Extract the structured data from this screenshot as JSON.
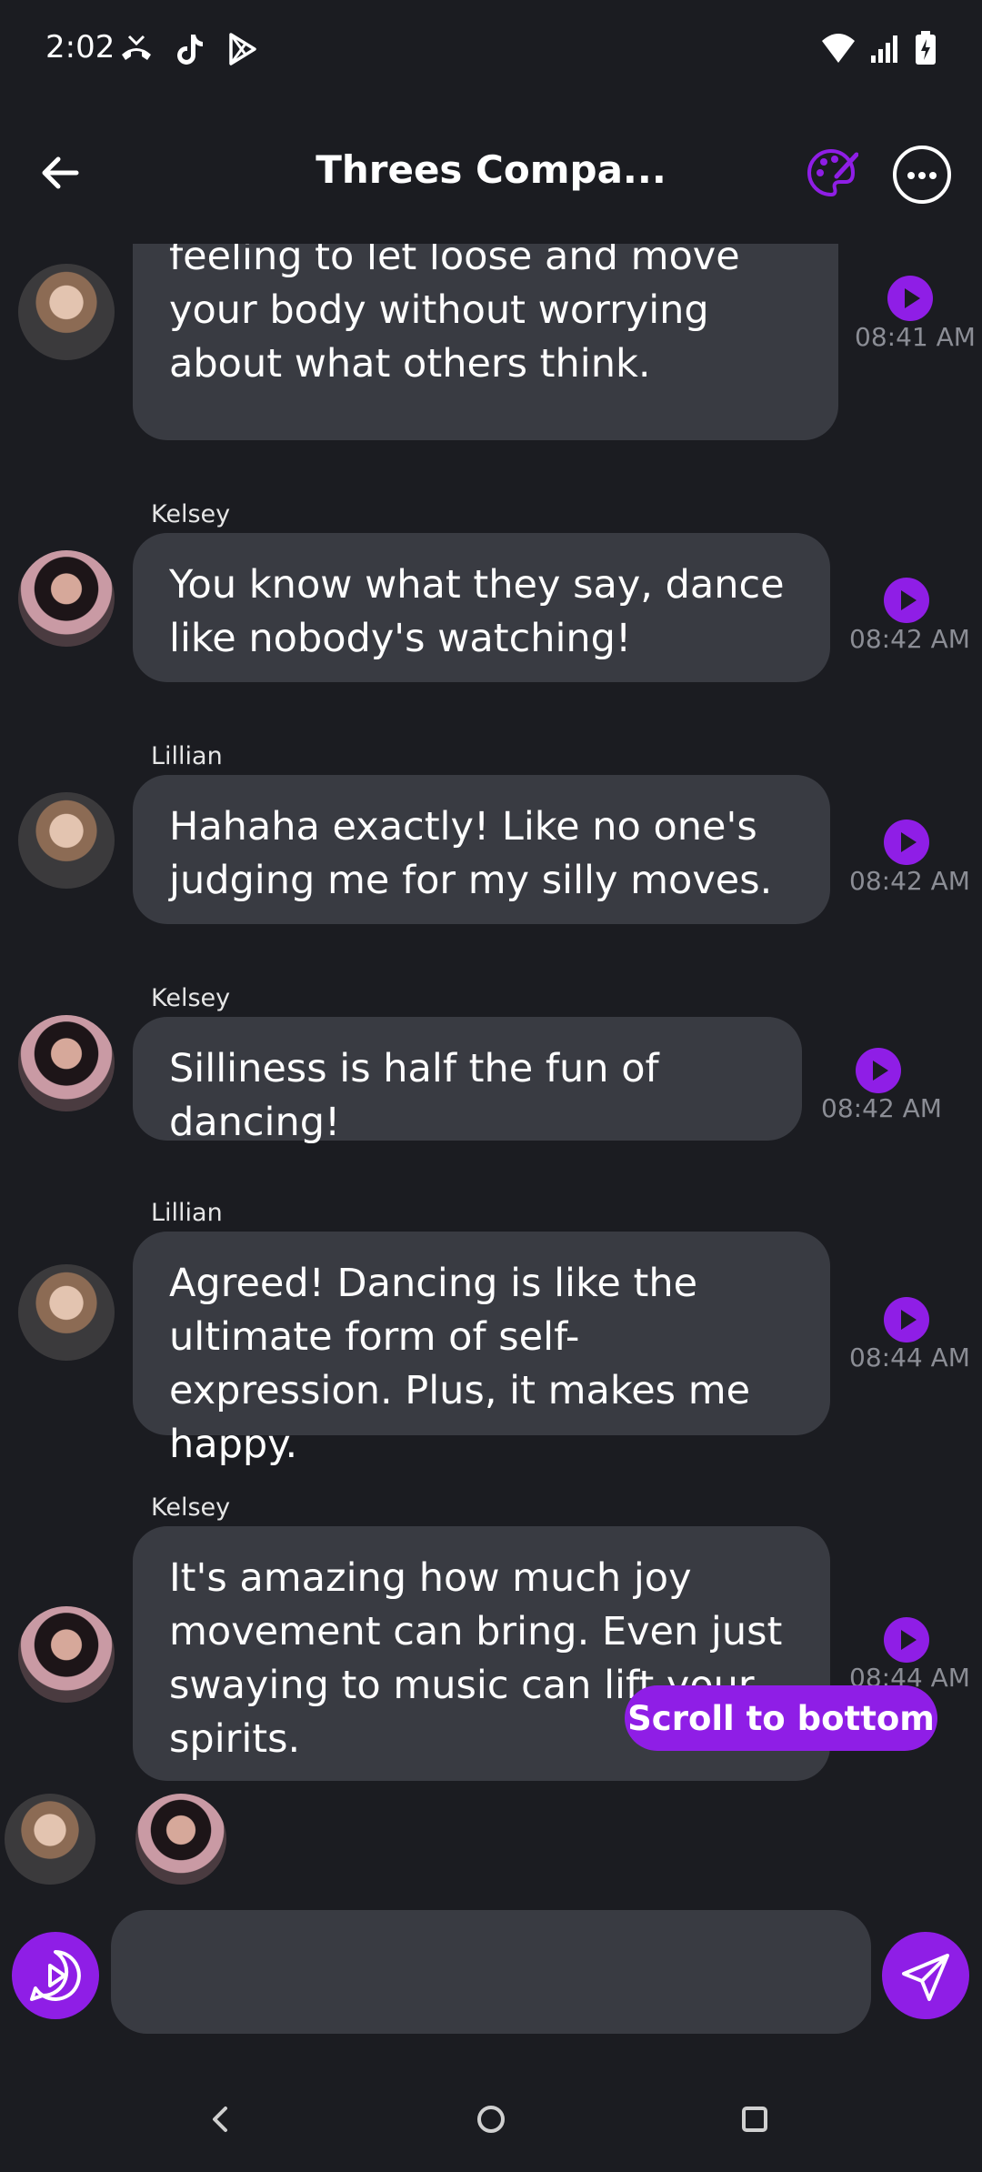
{
  "status_bar": {
    "time": "2:02",
    "app_icons": [
      "missed-call-icon",
      "tiktok-icon",
      "play-store-icon"
    ],
    "system_icons": [
      "wifi-icon",
      "signal-icon",
      "battery-charging-icon"
    ]
  },
  "header": {
    "title": "Threes Compa...",
    "icons": [
      "back-arrow-icon",
      "palette-icon",
      "more-horizontal-icon"
    ]
  },
  "messages": [
    {
      "sender": "",
      "avatar": "lillian",
      "text": "Of course! It's such a liberating feeling to let loose and move your body without worrying about what others think.",
      "time": "08:41 AM"
    },
    {
      "sender": "Kelsey",
      "avatar": "kelsey",
      "text": "You know what they say, dance like nobody's watching!",
      "time": "08:42 AM"
    },
    {
      "sender": "Lillian",
      "avatar": "lillian",
      "text": "Hahaha exactly! Like no one's judging me for my silly moves.",
      "time": "08:42 AM"
    },
    {
      "sender": "Kelsey",
      "avatar": "kelsey",
      "text": "Silliness is half the fun of dancing!",
      "time": "08:42 AM"
    },
    {
      "sender": "Lillian",
      "avatar": "lillian",
      "text": "Agreed! Dancing is like the ultimate form of self-expression. Plus, it makes me happy.",
      "time": "08:44 AM"
    },
    {
      "sender": "Kelsey",
      "avatar": "kelsey",
      "text": "It's amazing how much joy movement can bring. Even just swaying to music can lift your spirits.",
      "time": "08:44 AM"
    }
  ],
  "scroll_to_bottom_label": "Scroll to bottom",
  "typing_avatars": [
    "lillian",
    "kelsey"
  ],
  "composer": {
    "placeholder": "",
    "value": "",
    "icons": [
      "voice-chat-icon",
      "send-icon"
    ]
  },
  "colors": {
    "background": "#1b1c21",
    "bubble": "#393b42",
    "accent": "#8f1ee6",
    "timestamp": "#8b8d95"
  },
  "nav_bar": {
    "icons": [
      "back-nav-icon",
      "home-nav-icon",
      "recents-nav-icon"
    ]
  }
}
